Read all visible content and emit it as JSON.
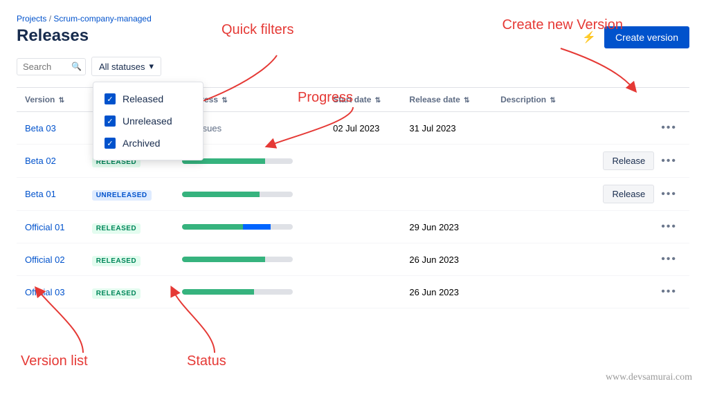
{
  "breadcrumb": {
    "projects": "Projects",
    "separator": "/",
    "project": "Scrum-company-managed"
  },
  "page": {
    "title": "Releases"
  },
  "toolbar": {
    "search_placeholder": "Search",
    "filter_btn_label": "All statuses",
    "create_btn_label": "Create version"
  },
  "dropdown": {
    "items": [
      {
        "id": "released",
        "label": "Released",
        "checked": true
      },
      {
        "id": "unreleased",
        "label": "Unreleased",
        "checked": true
      },
      {
        "id": "archived",
        "label": "Archived",
        "checked": true
      }
    ]
  },
  "table": {
    "columns": [
      {
        "id": "version",
        "label": "Version",
        "sortable": true
      },
      {
        "id": "status",
        "label": ""
      },
      {
        "id": "progress",
        "label": "Progress",
        "sortable": true
      },
      {
        "id": "start_date",
        "label": "Start date",
        "sortable": true
      },
      {
        "id": "release_date",
        "label": "Release date",
        "sortable": true
      },
      {
        "id": "description",
        "label": "Description",
        "sortable": true
      },
      {
        "id": "actions",
        "label": ""
      }
    ],
    "rows": [
      {
        "version": "Beta 03",
        "status": "",
        "status_label": "",
        "progress_text": "No issues",
        "start_date": "02 Jul 2023",
        "release_date": "31 Jul 2023",
        "description": "",
        "has_release_btn": false,
        "progress": null
      },
      {
        "version": "Beta 02",
        "status": "RELEASED",
        "status_type": "released",
        "progress_green": 75,
        "progress_blue": 0,
        "progress_gray": 25,
        "start_date": "",
        "release_date": "",
        "description": "",
        "has_release_btn": true,
        "release_btn_label": "Release"
      },
      {
        "version": "Beta 01",
        "status": "UNRELEASED",
        "status_type": "unreleased",
        "progress_green": 70,
        "progress_blue": 0,
        "progress_gray": 30,
        "start_date": "",
        "release_date": "",
        "description": "",
        "has_release_btn": true,
        "release_btn_label": "Release"
      },
      {
        "version": "Official 01",
        "status": "RELEASED",
        "status_type": "released",
        "progress_green": 55,
        "progress_blue": 25,
        "progress_gray": 20,
        "start_date": "",
        "release_date": "29 Jun 2023",
        "description": "",
        "has_release_btn": false
      },
      {
        "version": "Official 02",
        "status": "RELEASED",
        "status_type": "released",
        "progress_green": 75,
        "progress_blue": 0,
        "progress_gray": 25,
        "start_date": "",
        "release_date": "26 Jun 2023",
        "description": "",
        "has_release_btn": false
      },
      {
        "version": "Official 03",
        "status": "RELEASED",
        "status_type": "released",
        "progress_green": 65,
        "progress_blue": 0,
        "progress_gray": 35,
        "start_date": "",
        "release_date": "26 Jun 2023",
        "description": "",
        "has_release_btn": false
      }
    ]
  },
  "annotations": {
    "quick_filters": "Quick filters",
    "progress": "Progress",
    "create_new": "Create new Version",
    "version_list": "Version list",
    "status": "Status",
    "watermark": "www.devsamurai.com"
  }
}
